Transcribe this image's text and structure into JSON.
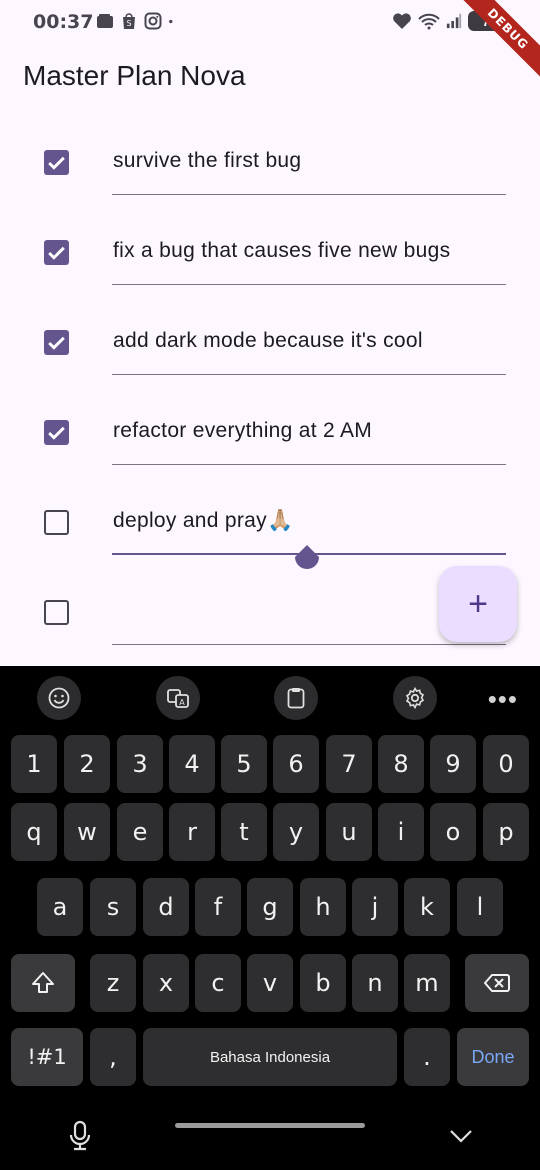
{
  "status_bar": {
    "time": "00:37",
    "battery": "7",
    "icons_left": [
      "wallet-icon",
      "shop-icon",
      "instagram-icon",
      "dot-icon"
    ],
    "icons_right": [
      "heart-icon",
      "wifi-icon",
      "signal-icon",
      "battery-icon"
    ]
  },
  "debug_banner": "DEBUG",
  "app": {
    "title": "Master Plan Nova",
    "accent_color": "#65558f",
    "tasks": [
      {
        "text": "survive the first bug",
        "checked": true
      },
      {
        "text": "fix a bug that causes five new bugs",
        "checked": true
      },
      {
        "text": "add dark mode because it's cool",
        "checked": true
      },
      {
        "text": "refactor everything at 2 AM",
        "checked": true
      },
      {
        "text": "deploy and pray🙏🏼",
        "checked": false,
        "focused": true
      },
      {
        "text": "",
        "checked": false
      }
    ],
    "fab_label": "+"
  },
  "keyboard": {
    "toolbar": [
      "emoji-icon",
      "translate-icon",
      "clipboard-icon",
      "settings-icon",
      "more-icon"
    ],
    "more_label": "•••",
    "row_numbers": [
      "1",
      "2",
      "3",
      "4",
      "5",
      "6",
      "7",
      "8",
      "9",
      "0"
    ],
    "row_top": [
      "q",
      "w",
      "e",
      "r",
      "t",
      "y",
      "u",
      "i",
      "o",
      "p"
    ],
    "row_middle": [
      "a",
      "s",
      "d",
      "f",
      "g",
      "h",
      "j",
      "k",
      "l"
    ],
    "row_bottom": [
      "z",
      "x",
      "c",
      "v",
      "b",
      "n",
      "m"
    ],
    "symbols_label": "!#1",
    "comma_label": ",",
    "space_label": "Bahasa Indonesia",
    "period_label": ".",
    "done_label": "Done"
  }
}
